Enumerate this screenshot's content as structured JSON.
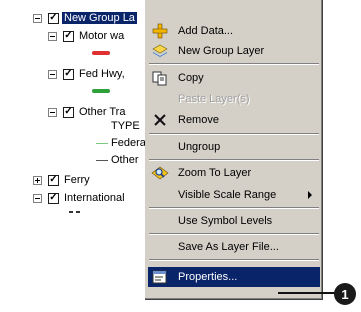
{
  "toc": {
    "nodes": [
      {
        "label": "New Group La",
        "checked": "✓",
        "expander": "minus",
        "selected": true
      },
      {
        "label": "Motor wa",
        "checked": "✓",
        "expander": "minus"
      },
      {
        "label": "Fed Hwy,",
        "checked": "✓",
        "expander": "minus"
      },
      {
        "label": "Other Tra",
        "checked": "✓",
        "expander": "minus"
      },
      {
        "label": "Ferry",
        "checked": "✓",
        "expander": "plus"
      },
      {
        "label": "International",
        "checked": "✓",
        "expander": "minus"
      }
    ],
    "type_label": "TYPE",
    "legend": [
      {
        "label": "Federa",
        "color": "#7fc97f"
      },
      {
        "label": "Other",
        "color": "#555555"
      }
    ],
    "swatch_colors": {
      "motorway": "#e03030",
      "fed_hwy": "#2ea03a"
    }
  },
  "menu": {
    "items": [
      {
        "label": "Add Data...",
        "icon": "add-data-icon",
        "underline": "t"
      },
      {
        "label": "New Group Layer",
        "icon": "group-layer-icon",
        "underline": "G"
      },
      {
        "label": "Copy",
        "icon": "copy-icon",
        "underline": "C"
      },
      {
        "label": "Paste Layer(s)",
        "icon": "",
        "disabled": true
      },
      {
        "label": "Remove",
        "icon": "remove-icon",
        "underline": "R"
      },
      {
        "label": "Ungroup",
        "icon": "",
        "underline": "U"
      },
      {
        "label": "Zoom To Layer",
        "icon": "zoom-to-layer-icon",
        "underline": "Z"
      },
      {
        "label": "Visible Scale Range",
        "icon": "",
        "underline": "V",
        "submenu": true
      },
      {
        "label": "Use Symbol Levels",
        "icon": "",
        "underline": "U"
      },
      {
        "label": "Save As Layer File...",
        "icon": "",
        "underline": "y"
      },
      {
        "label": "Properties...",
        "icon": "properties-icon",
        "underline": "I",
        "highlighted": true
      }
    ]
  },
  "callout": {
    "number": "1"
  },
  "colors": {
    "menu_bg": "#d4d0c8",
    "highlight": "#0a246a"
  }
}
